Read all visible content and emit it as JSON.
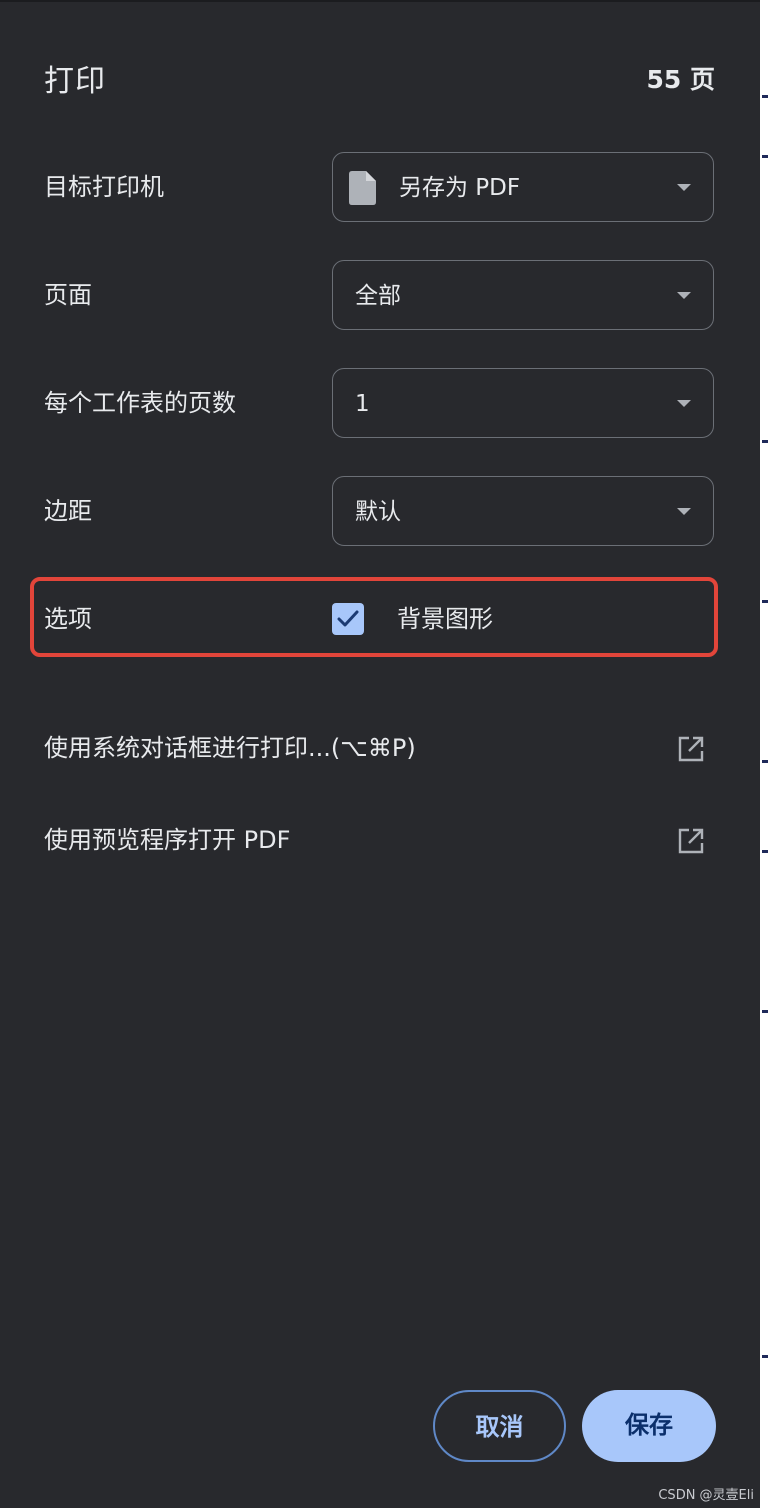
{
  "header": {
    "title": "打印",
    "page_count": "55 页"
  },
  "settings": {
    "destination": {
      "label": "目标打印机",
      "value": "另存为 PDF",
      "icon": "document-icon"
    },
    "pages": {
      "label": "页面",
      "value": "全部"
    },
    "pages_per_sheet": {
      "label": "每个工作表的页数",
      "value": "1"
    },
    "margins": {
      "label": "边距",
      "value": "默认"
    },
    "options": {
      "label": "选项",
      "checkbox_label": "背景图形",
      "checked": true
    }
  },
  "links": {
    "system_dialog": {
      "label": "使用系统对话框进行打印...(⌥⌘P)",
      "icon": "open-in-new-icon"
    },
    "open_preview": {
      "label": "使用预览程序打开 PDF",
      "icon": "open-in-new-icon"
    }
  },
  "buttons": {
    "cancel": "取消",
    "save": "保存"
  },
  "watermark": "CSDN @灵壹Eli",
  "colors": {
    "background": "#28292d",
    "text": "#e8eaed",
    "accent": "#a8c7fa",
    "highlight_border": "#e2453a",
    "select_border": "#6b6f76"
  }
}
